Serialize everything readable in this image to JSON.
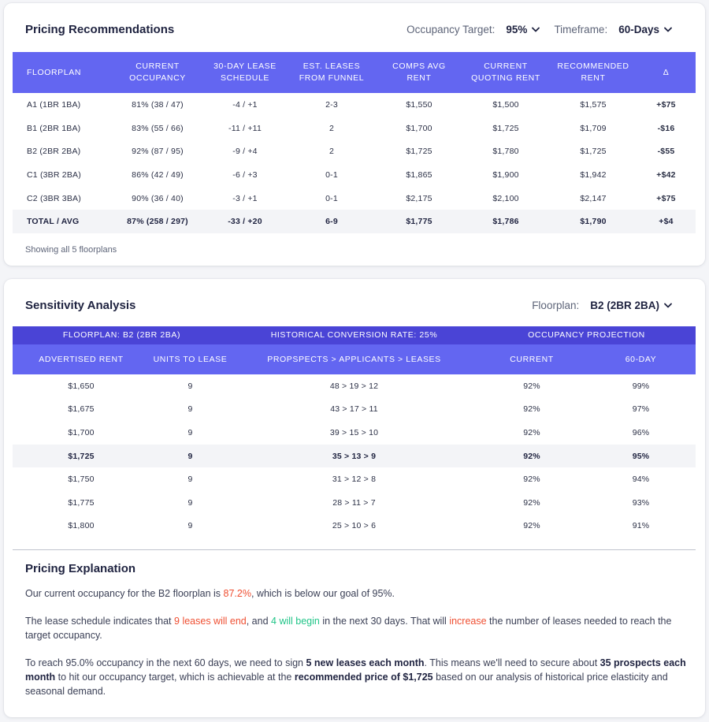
{
  "pricing": {
    "title": "Pricing Recommendations",
    "occupancy_label": "Occupancy Target:",
    "occupancy_value": "95%",
    "timeframe_label": "Timeframe:",
    "timeframe_value": "60-Days",
    "columns": [
      "FLOORPLAN",
      "CURRENT OCCUPANCY",
      "30-DAY LEASE SCHEDULE",
      "EST. LEASES FROM FUNNEL",
      "COMPS AVG RENT",
      "CURRENT QUOTING RENT",
      "RECOMMENDED RENT",
      "Δ"
    ],
    "rows": [
      [
        "A1 (1BR 1BA)",
        "81% (38 / 47)",
        "-4 / +1",
        "2-3",
        "$1,550",
        "$1,500",
        "$1,575",
        "+$75"
      ],
      [
        "B1 (2BR 1BA)",
        "83% (55 / 66)",
        "-11 / +11",
        "2",
        "$1,700",
        "$1,725",
        "$1,709",
        "-$16"
      ],
      [
        "B2 (2BR 2BA)",
        "92% (87 / 95)",
        "-9 / +4",
        "2",
        "$1,725",
        "$1,780",
        "$1,725",
        "-$55"
      ],
      [
        "C1 (3BR 2BA)",
        "86% (42 / 49)",
        "-6 / +3",
        "0-1",
        "$1,865",
        "$1,900",
        "$1,942",
        "+$42"
      ],
      [
        "C2 (3BR 3BA)",
        "90% (36 / 40)",
        "-3 / +1",
        "0-1",
        "$2,175",
        "$2,100",
        "$2,147",
        "+$75"
      ]
    ],
    "total": [
      "TOTAL / AVG",
      "87% (258 / 297)",
      "-33 / +20",
      "6-9",
      "$1,775",
      "$1,786",
      "$1,790",
      "+$4"
    ],
    "footnote": "Showing all 5 floorplans"
  },
  "sensitivity": {
    "title": "Sensitivity Analysis",
    "floorplan_label": "Floorplan:",
    "floorplan_value": "B2 (2BR 2BA)",
    "group_headers": [
      "FLOORPLAN: B2 (2BR 2BA)",
      "HISTORICAL CONVERSION RATE: 25%",
      "OCCUPANCY PROJECTION"
    ],
    "columns": [
      "ADVERTISED RENT",
      "UNITS TO LEASE",
      "PROPSPECTS > APPLICANTS > LEASES",
      "CURRENT",
      "60-DAY"
    ],
    "rows": [
      [
        "$1,650",
        "9",
        "48 > 19 > 12",
        "92%",
        "99%"
      ],
      [
        "$1,675",
        "9",
        "43 > 17 > 11",
        "92%",
        "97%"
      ],
      [
        "$1,700",
        "9",
        "39 > 15 > 10",
        "92%",
        "96%"
      ],
      [
        "$1,725",
        "9",
        "35 > 13 > 9",
        "92%",
        "95%"
      ],
      [
        "$1,750",
        "9",
        "31 > 12 > 8",
        "92%",
        "94%"
      ],
      [
        "$1,775",
        "9",
        "28 > 11 > 7",
        "92%",
        "93%"
      ],
      [
        "$1,800",
        "9",
        "25 > 10 > 6",
        "92%",
        "91%"
      ]
    ]
  },
  "explanation": {
    "title": "Pricing Explanation",
    "p1": {
      "a": "Our current occupancy for the B2 floorplan is ",
      "b": "87.2%",
      "c": ", which is below our goal of 95%."
    },
    "p2": {
      "a": "The lease schedule indicates that ",
      "b": "9 leases will end",
      "c": ", and ",
      "d": "4 will begin",
      "e": " in the next 30 days. That will ",
      "f": "increase",
      "g": " the number of leases needed to reach the target occupancy."
    },
    "p3": {
      "a": "To reach 95.0% occupancy in the next 60 days, we need to sign ",
      "b": "5 new leases each month",
      "c": ". This means we'll need to secure about ",
      "d": "35 prospects each month",
      "e": " to hit our occupancy target, which is achievable at the ",
      "f": "recommended price of $1,725",
      "g": " based on our analysis of historical price elasticity and seasonal demand."
    }
  },
  "colors": {
    "header": "#6366f1",
    "header_dark": "#4a44d6",
    "positive": "#1fc487",
    "negative": "#ef4f32"
  },
  "icons": [
    "chevron-down-icon"
  ]
}
